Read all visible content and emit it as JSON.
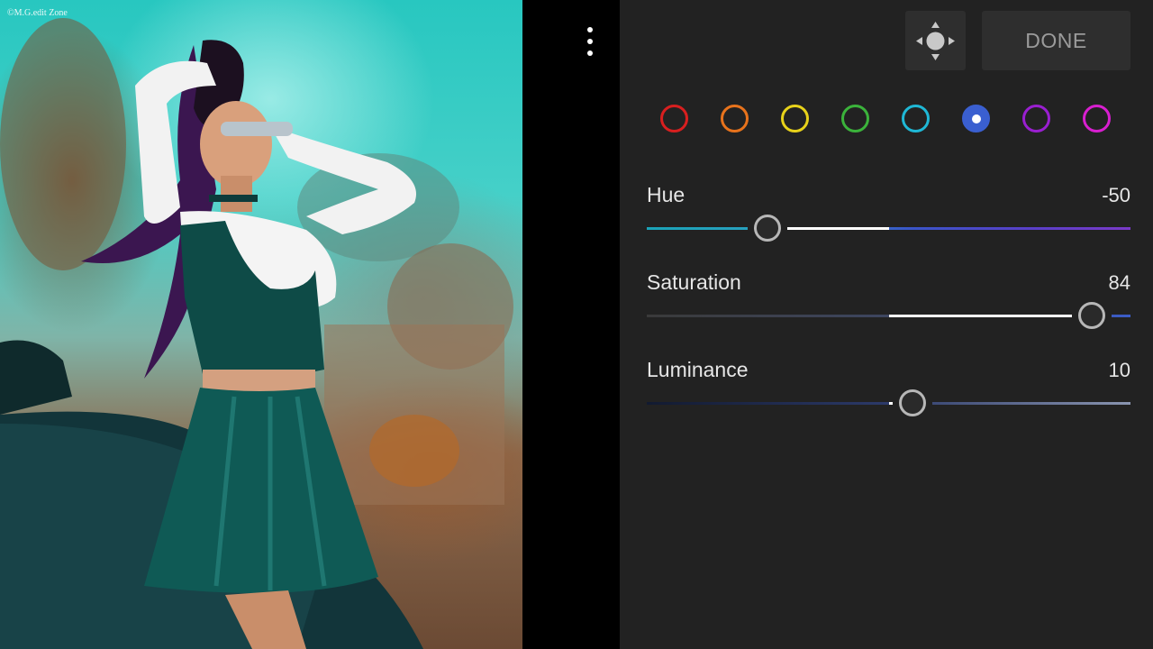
{
  "photo": {
    "watermark": "©M.G.edit Zone"
  },
  "toolbar": {
    "done_label": "DONE",
    "move_icon": "move-arrows-icon",
    "more_icon": "more-vertical-icon"
  },
  "colors": {
    "swatches": [
      {
        "name": "red",
        "hex": "#d81f1f"
      },
      {
        "name": "orange",
        "hex": "#e8731c"
      },
      {
        "name": "yellow",
        "hex": "#e8d21a"
      },
      {
        "name": "green",
        "hex": "#3bb33b"
      },
      {
        "name": "aqua",
        "hex": "#1fb8d6"
      },
      {
        "name": "blue",
        "hex": "#3a5fd0",
        "selected": true
      },
      {
        "name": "purple",
        "hex": "#9a1fd0"
      },
      {
        "name": "magenta",
        "hex": "#d81fd0"
      }
    ]
  },
  "sliders": {
    "hue": {
      "label": "Hue",
      "value": "-50",
      "level": -50,
      "min": -100,
      "max": 100
    },
    "saturation": {
      "label": "Saturation",
      "value": "84",
      "level": 84,
      "min": -100,
      "max": 100
    },
    "luminance": {
      "label": "Luminance",
      "value": "10",
      "level": 10,
      "min": -100,
      "max": 100
    }
  }
}
